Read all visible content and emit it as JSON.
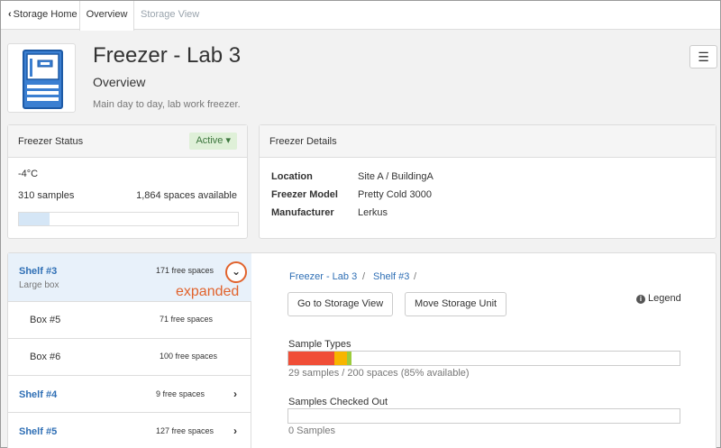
{
  "tabs": {
    "home": "Storage Home",
    "overview": "Overview",
    "storage_view": "Storage View"
  },
  "header": {
    "title": "Freezer - Lab 3",
    "subtitle": "Overview",
    "description": "Main day to day, lab work freezer.",
    "menu_icon": "hamburger-icon",
    "freezer_icon": "freezer-icon"
  },
  "status_panel": {
    "heading": "Freezer Status",
    "badge": "Active",
    "temperature": "-4°C",
    "samples": "310 samples",
    "spaces_available": "1,864 spaces available",
    "capacity_used_fraction": 0.14
  },
  "details_panel": {
    "heading": "Freezer Details",
    "location_label": "Location",
    "location_value": "Site A / BuildingA",
    "model_label": "Freezer Model",
    "model_value": "Pretty Cold 3000",
    "manufacturer_label": "Manufacturer",
    "manufacturer_value": "Lerkus"
  },
  "shelves": {
    "shelf3": {
      "name": "Shelf #3",
      "sub": "Large box",
      "free": "171 free spaces"
    },
    "box5": {
      "name": "Box #5",
      "free": "71 free spaces"
    },
    "box6": {
      "name": "Box #6",
      "free": "100 free spaces"
    },
    "shelf4": {
      "name": "Shelf #4",
      "free": "9 free spaces"
    },
    "shelf5": {
      "name": "Shelf #5",
      "free": "127 free spaces"
    },
    "annotation": "expanded"
  },
  "detail": {
    "crumb1": "Freezer - Lab 3",
    "crumb2": "Shelf #3",
    "sep": "/",
    "go_button": "Go to Storage View",
    "move_button": "Move Storage Unit",
    "legend": "Legend",
    "sample_types_label": "Sample Types",
    "sample_types_caption": "29 samples / 200 spaces (85% available)",
    "sample_type_segments": [
      {
        "color": "#f04e37",
        "fraction": 0.117
      },
      {
        "color": "#f7b500",
        "fraction": 0.033
      },
      {
        "color": "#9ccc3c",
        "fraction": 0.012
      }
    ],
    "checked_out_label": "Samples Checked Out",
    "checked_out_caption": "0 Samples",
    "checked_out_fraction": 0
  }
}
